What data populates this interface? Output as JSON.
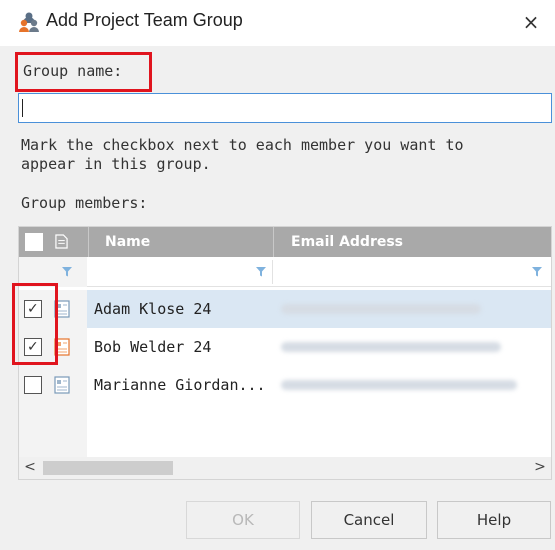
{
  "window": {
    "title": "Add Project Team Group",
    "close_glyph": "×"
  },
  "form": {
    "group_name_label": "Group name:",
    "group_name_value": "",
    "instructions": "Mark the checkbox next to each member you want to appear in this group.",
    "instructions_line1": "Mark the checkbox next to each member you want to",
    "instructions_line2": "appear in this group.",
    "members_label": "Group members:"
  },
  "grid": {
    "columns": [
      "Name",
      "Email Address"
    ],
    "rows": [
      {
        "name": "Adam Klose 24",
        "checked": true,
        "icon": "contact-card-icon",
        "selected": true
      },
      {
        "name": "Bob Welder 24",
        "checked": true,
        "icon": "contact-card-icon-orange",
        "selected": false
      },
      {
        "name": "Marianne Giordan...",
        "checked": false,
        "icon": "contact-card-icon",
        "selected": false
      }
    ],
    "scroll_left": "<",
    "scroll_right": ">"
  },
  "buttons": {
    "ok": "OK",
    "cancel": "Cancel",
    "help": "Help"
  },
  "colors": {
    "highlight_box": "#e0141e",
    "header_bg": "#a9a9a9",
    "selected_row": "#dae7f3",
    "input_border": "#4a90d9"
  }
}
